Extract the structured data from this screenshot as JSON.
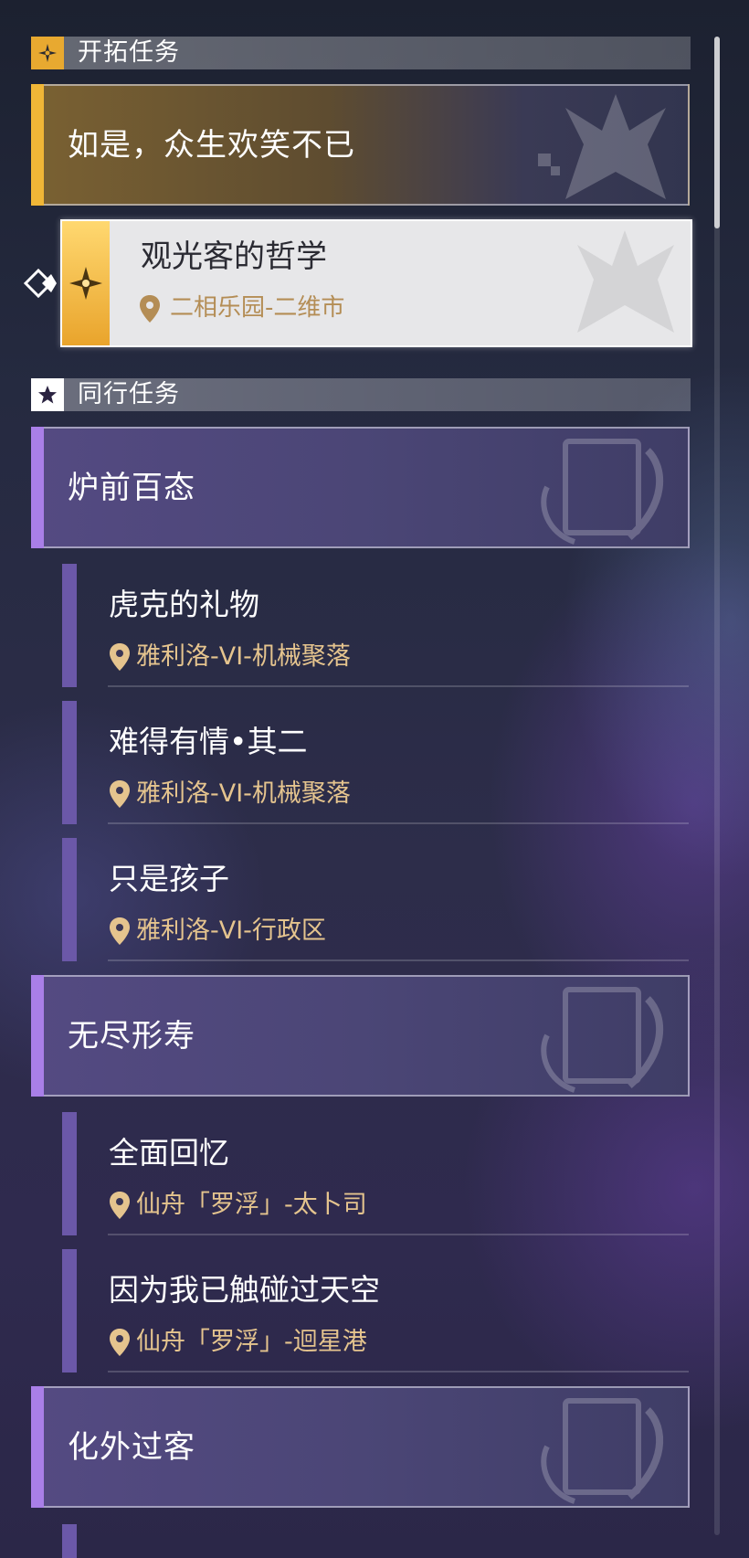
{
  "trailblaze": {
    "header": "开拓任务",
    "main_title": "如是，众生欢笑不已",
    "active_task": {
      "title": "观光客的哲学",
      "location": "二相乐园-二维市"
    }
  },
  "companion": {
    "header": "同行任务",
    "groups": [
      {
        "title": "炉前百态",
        "items": [
          {
            "title": "虎克的礼物",
            "location": "雅利洛-VI-机械聚落"
          },
          {
            "title": "难得有情•其二",
            "location": "雅利洛-VI-机械聚落"
          },
          {
            "title": "只是孩子",
            "location": "雅利洛-VI-行政区"
          }
        ]
      },
      {
        "title": "无尽形寿",
        "items": [
          {
            "title": "全面回忆",
            "location": "仙舟「罗浮」-太卜司"
          },
          {
            "title": "因为我已触碰过天空",
            "location": "仙舟「罗浮」-迴星港"
          }
        ]
      },
      {
        "title": "化外过客",
        "items": []
      }
    ]
  },
  "colors": {
    "trailblaze_accent": "#f0b637",
    "companion_accent": "#a97fe8",
    "location_text": "#e5c48e"
  }
}
